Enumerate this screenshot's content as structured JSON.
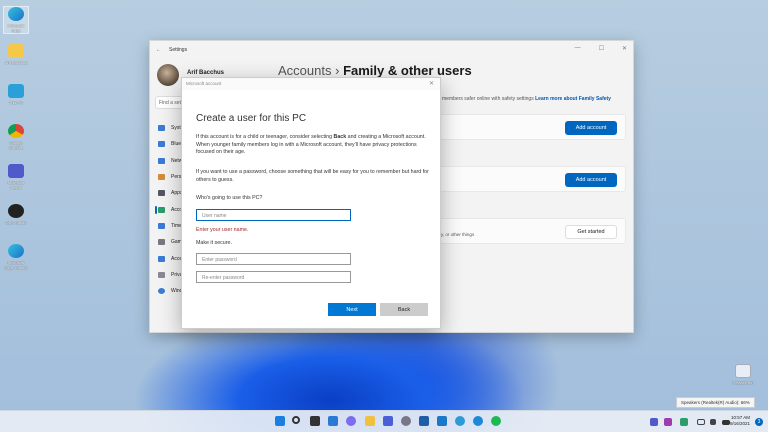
{
  "desktop": {
    "icons": [
      "Microsoft Edge",
      "Arif Bacchus",
      "This PC",
      "Google Chrome",
      "Microsoft Teams",
      "OBS Studio",
      "Microsoft Edge Canary",
      "Recycle Bin"
    ]
  },
  "settings": {
    "title": "Settings",
    "user": "Arif Bacchus",
    "search_placeholder": "Find a setting",
    "sidebar": [
      "System",
      "Bluetooth & devices",
      "Network & internet",
      "Personalization",
      "Apps",
      "Accounts",
      "Time & language",
      "Gaming",
      "Accessibility",
      "Privacy & security",
      "Windows Update"
    ],
    "breadcrumb_parent": "Accounts",
    "breadcrumb_sep": "›",
    "page_title": "Family & other users",
    "family_desc": "members safer online with safety settings",
    "family_link": "Learn more about Family Safety",
    "add_account_1": "Add account",
    "add_account_2": "Add account",
    "kiosk_desc": "play, or other things",
    "get_started": "Get started"
  },
  "dialog": {
    "title": "Microsoft account",
    "heading": "Create a user for this PC",
    "p1_a": "If this account is for a child or teenager, consider selecting ",
    "p1_bold": "Back",
    "p1_b": " and creating a Microsoft account. When younger family members log in with a Microsoft account, they'll have privacy protections focused on their age.",
    "p2": "If you want to use a password, choose something that will be easy for you to remember but hard for others to guess.",
    "who_label": "Who's going to use this PC?",
    "username_placeholder": "User name",
    "error": "Enter your user name.",
    "secure_label": "Make it secure.",
    "password_placeholder": "Enter password",
    "reenter_placeholder": "Re-enter password",
    "next": "Next",
    "back": "Back"
  },
  "taskbar": {
    "tooltip": "Speakers (Realtek(R) Audio): 66%",
    "time": "10:57 AM",
    "date": "9/16/2021",
    "notification_count": "3"
  }
}
